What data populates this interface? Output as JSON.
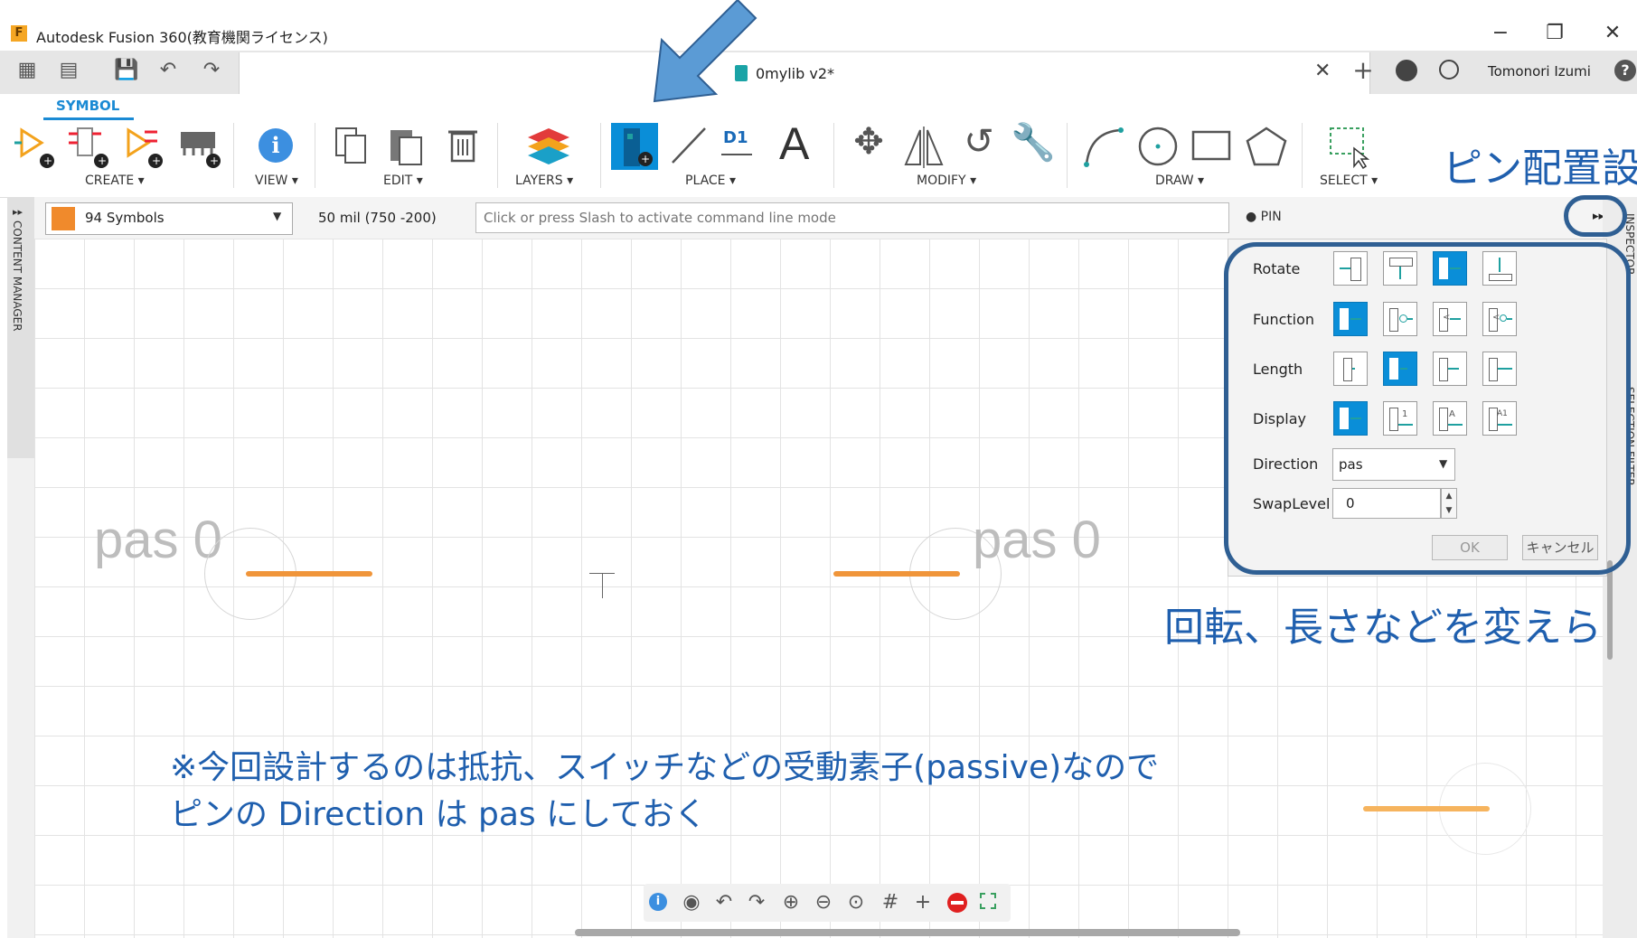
{
  "window": {
    "title": "Autodesk Fusion 360(教育機関ライセンス)",
    "logo_letter": "F",
    "controls": {
      "minimize": "−",
      "restore": "❐",
      "close": "✕"
    }
  },
  "tabbar": {
    "doc_title": "0mylib v2*",
    "close": "✕",
    "add": "+",
    "user_name": "Tomonori Izumi",
    "help": "?"
  },
  "toolbar": {
    "active_tab": "SYMBOL",
    "groups": {
      "create": "CREATE ▾",
      "view": "VIEW ▾",
      "edit": "EDIT ▾",
      "layers": "LAYERS ▾",
      "place": "PLACE ▾",
      "modify": "MODIFY ▾",
      "draw": "DRAW ▾",
      "select": "SELECT ▾"
    },
    "place_text_icon": "A",
    "place_d1_icon": "D1"
  },
  "commandbar": {
    "layer_value": "94 Symbols",
    "layer_color": "#f08a2c",
    "grid_info": "50 mil (750 -200)",
    "command_placeholder": "Click or press Slash to activate command line mode",
    "pin_label": "● PIN",
    "expand": "▸▸"
  },
  "side": {
    "content_manager": "CONTENT MANAGER",
    "inspector": "INSPECTOR",
    "selection_filter": "SELECTION FILTER"
  },
  "pin_panel": {
    "rotate_label": "Rotate",
    "function_label": "Function",
    "length_label": "Length",
    "display_label": "Display",
    "direction_label": "Direction",
    "direction_value": "pas",
    "swaplevel_label": "SwapLevel",
    "swaplevel_value": "0",
    "ok": "OK",
    "cancel": "キャンセル",
    "display_icon_labels": [
      "1",
      "A",
      "A1"
    ]
  },
  "canvas": {
    "pin1_text": "pas 0",
    "pin2_text": "pas 0"
  },
  "annotations": {
    "title_partial": "ピン配置設",
    "note_right": "回転、長さなどを変えら",
    "note_bottom_1": "※今回設計するのは抵抗、スイッチなどの受動素子(passive)なので",
    "note_bottom_2": "ピンの Direction は pas にしておく",
    "arrow_color": "#5b9bd5",
    "box_color": "#2f5f93"
  },
  "navbar": {
    "icons": [
      "info-icon",
      "eye-icon",
      "undo-icon",
      "redo-icon",
      "zoom-in-icon",
      "zoom-out-icon",
      "zoom-fit-icon",
      "grid-icon",
      "crosshair-icon",
      "stop-icon",
      "select-window-icon"
    ]
  }
}
